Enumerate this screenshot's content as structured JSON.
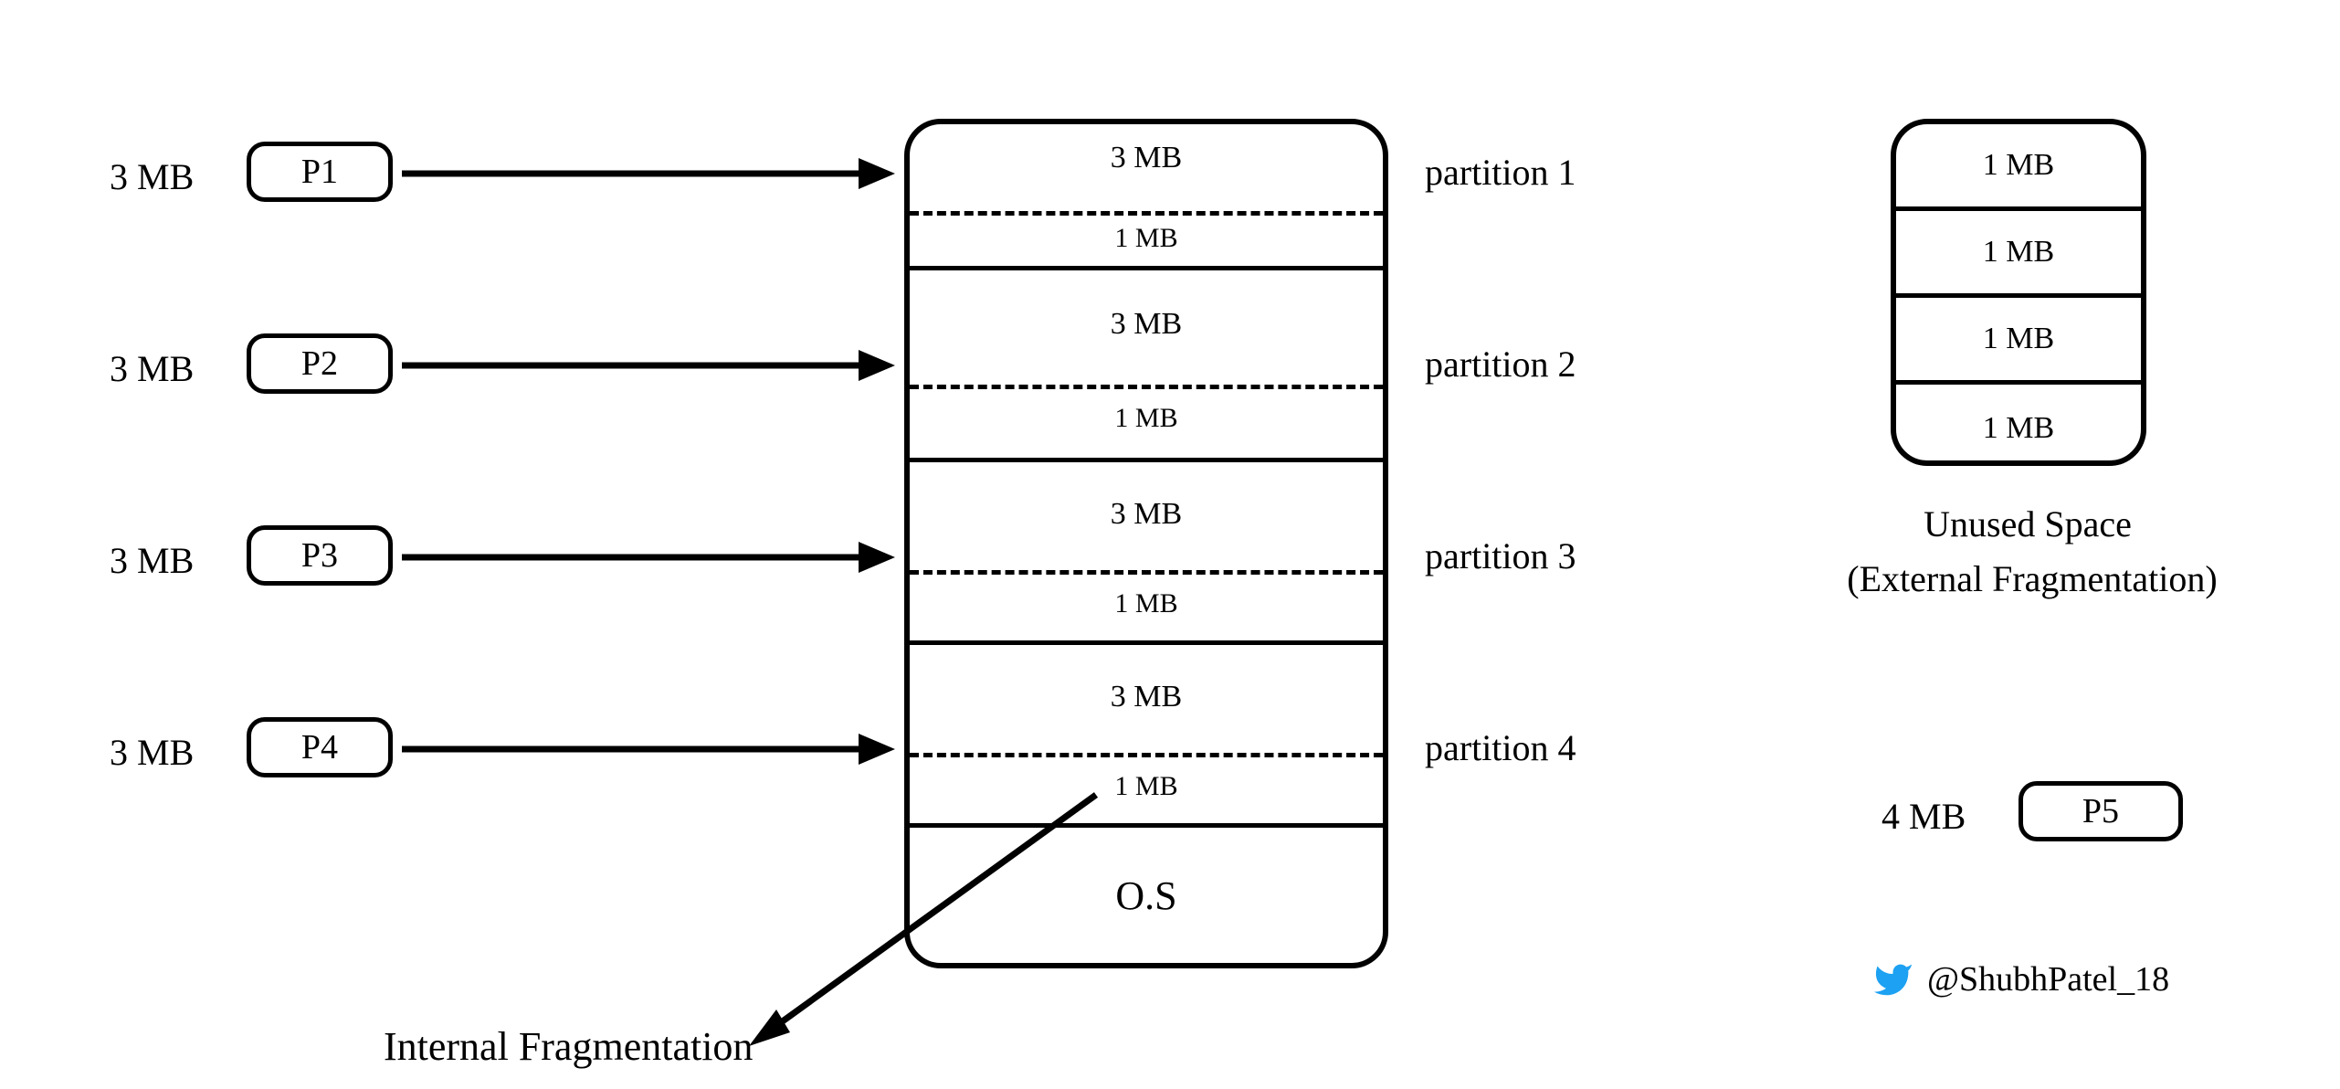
{
  "processes": [
    {
      "size_label": "3 MB",
      "name": "P1"
    },
    {
      "size_label": "3 MB",
      "name": "P2"
    },
    {
      "size_label": "3 MB",
      "name": "P3"
    },
    {
      "size_label": "3 MB",
      "name": "P4"
    }
  ],
  "memory": {
    "partitions": [
      {
        "top_label": "3 MB",
        "bottom_label": "1 MB",
        "side_label": "partition 1"
      },
      {
        "top_label": "3 MB",
        "bottom_label": "1 MB",
        "side_label": "partition 2"
      },
      {
        "top_label": "3 MB",
        "bottom_label": "1 MB",
        "side_label": "partition 3"
      },
      {
        "top_label": "3 MB",
        "bottom_label": "1 MB",
        "side_label": "partition 4"
      }
    ],
    "os_label": "O.S"
  },
  "internal_frag_label": "Internal Fragmentation",
  "unused": {
    "rows": [
      "1 MB",
      "1 MB",
      "1 MB",
      "1 MB"
    ],
    "caption_line1": "Unused Space",
    "caption_line2": "(External Fragmentation)"
  },
  "waiting_process": {
    "size_label": "4 MB",
    "name": "P5"
  },
  "credit": {
    "handle": "@ShubhPatel_18"
  }
}
